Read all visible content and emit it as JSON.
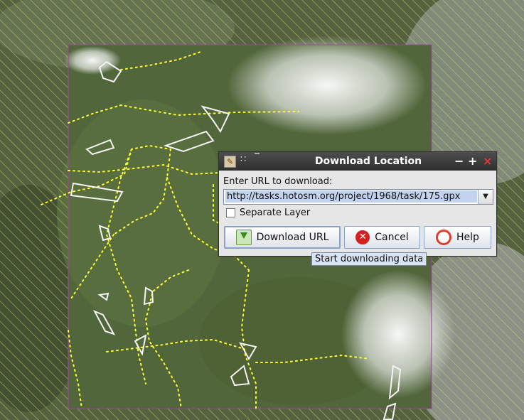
{
  "dialog": {
    "title": "Download Location",
    "prompt": "Enter URL to download:",
    "url_value": "http://tasks.hotosm.org/project/1968/task/175.gpx",
    "separate_layer_label": "Separate Layer",
    "separate_layer_checked": false,
    "buttons": {
      "download": "Download URL",
      "cancel": "Cancel",
      "help": "Help"
    },
    "window_controls": {
      "minimize": "−",
      "maximize": "+",
      "close": "×"
    }
  },
  "tooltip": "Start downloading data",
  "colors": {
    "selection_border": "#b03bb0",
    "gps_track": "#ffff33",
    "polygons": "#ffffff",
    "hatch": "#d8e07a"
  },
  "icons": [
    "app-icon",
    "menu-icon",
    "shade-icon",
    "download-icon",
    "cancel-icon",
    "help-icon",
    "chevron-down-icon"
  ]
}
